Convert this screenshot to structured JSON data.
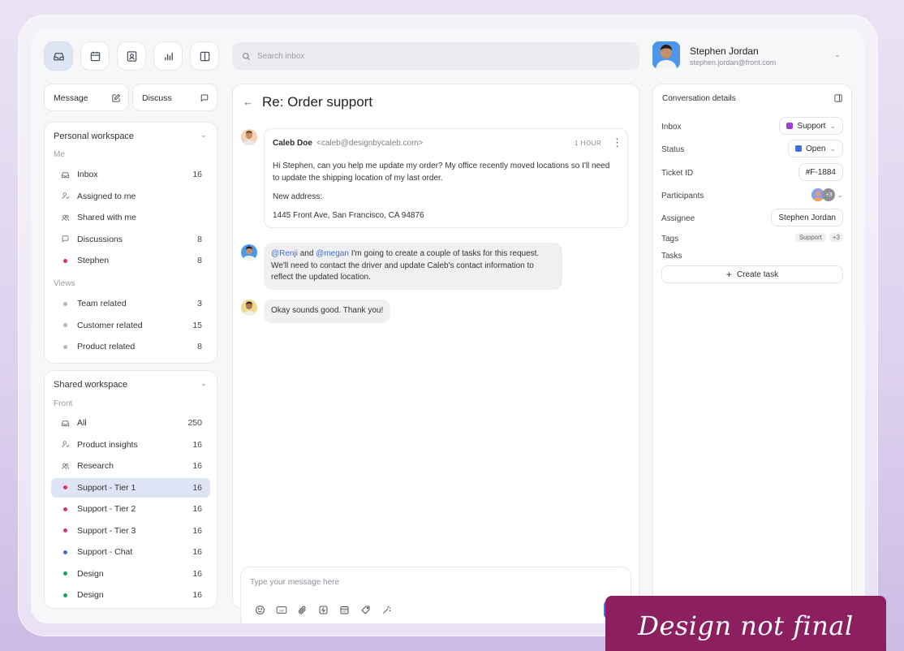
{
  "toolbar": {
    "icons": [
      "inbox-icon",
      "calendar-icon",
      "contacts-icon",
      "analytics-icon",
      "layout-icon"
    ]
  },
  "search": {
    "placeholder": "Search inbox"
  },
  "user": {
    "name": "Stephen Jordan",
    "email": "stephen.jordan@front.com"
  },
  "compose": {
    "message_label": "Message",
    "discuss_label": "Discuss"
  },
  "personal": {
    "title": "Personal workspace",
    "me_label": "Me",
    "items": [
      {
        "label": "Inbox",
        "count": "16",
        "icon": "inbox-icon"
      },
      {
        "label": "Assigned to me",
        "count": "",
        "icon": "assign-icon"
      },
      {
        "label": "Shared with me",
        "count": "",
        "icon": "shared-icon"
      },
      {
        "label": "Discussions",
        "count": "8",
        "icon": "chat-icon"
      },
      {
        "label": "Stephen",
        "count": "8",
        "icon": "dot",
        "color": "#d23a5c"
      }
    ],
    "views_label": "Views",
    "views": [
      {
        "label": "Team related",
        "count": "3",
        "color": "#b5b7c0"
      },
      {
        "label": "Customer related",
        "count": "15",
        "color": "#b5b7c0"
      },
      {
        "label": "Product related",
        "count": "8",
        "color": "#b5b7c0"
      }
    ]
  },
  "shared": {
    "title": "Shared workspace",
    "front_label": "Front",
    "items": [
      {
        "label": "All",
        "count": "250",
        "icon": "inbox-icon"
      },
      {
        "label": "Product insights",
        "count": "16",
        "icon": "assign-icon"
      },
      {
        "label": "Research",
        "count": "16",
        "icon": "shared-icon"
      },
      {
        "label": "Support - Tier 1",
        "count": "16",
        "color": "#d23a5c",
        "selected": true
      },
      {
        "label": "Support - Tier 2",
        "count": "16",
        "color": "#d23a5c"
      },
      {
        "label": "Support - Tier 3",
        "count": "16",
        "color": "#d23a5c"
      },
      {
        "label": "Support - Chat",
        "count": "16",
        "color": "#3f6fd9"
      },
      {
        "label": "Design",
        "count": "16",
        "color": "#22a05a"
      },
      {
        "label": "Design",
        "count": "16",
        "color": "#22a05a"
      }
    ]
  },
  "conversation": {
    "title": "Re: Order support",
    "email": {
      "sender": "Caleb Doe",
      "address": "<caleb@designbycaleb.com>",
      "time": "1 HOUR",
      "p1": "Hi Stephen, can you help me update my order? My office recently moved locations so I'll need to update the shipping location of my last order.",
      "p2": "New address:",
      "p3": "1445 Front Ave, San Francisco, CA 94876"
    },
    "comment": {
      "mention1": "@Renji",
      "and": " and ",
      "mention2": "@megan",
      "text": " I'm going to create a couple of tasks for this request. We'll need to contact the driver and update Caleb's contact information to reflect the updated location."
    },
    "reply": "Okay sounds good. Thank you!",
    "composer": {
      "placeholder": "Type your message here"
    }
  },
  "details": {
    "title": "Conversation details",
    "inbox_label": "Inbox",
    "inbox_value": "Support",
    "inbox_color": "#9a3ee0",
    "status_label": "Status",
    "status_value": "Open",
    "status_color": "#3f6fd9",
    "ticket_label": "Ticket ID",
    "ticket_value": "#F-1884",
    "participants_label": "Participants",
    "participants_more": "+3",
    "assignee_label": "Assignee",
    "assignee_value": "Stephen Jordan",
    "tags_label": "Tags",
    "tag_value": "Support",
    "tag_more": "+3",
    "tasks_label": "Tasks",
    "create_task": "Create task"
  },
  "banner": "Design not final"
}
